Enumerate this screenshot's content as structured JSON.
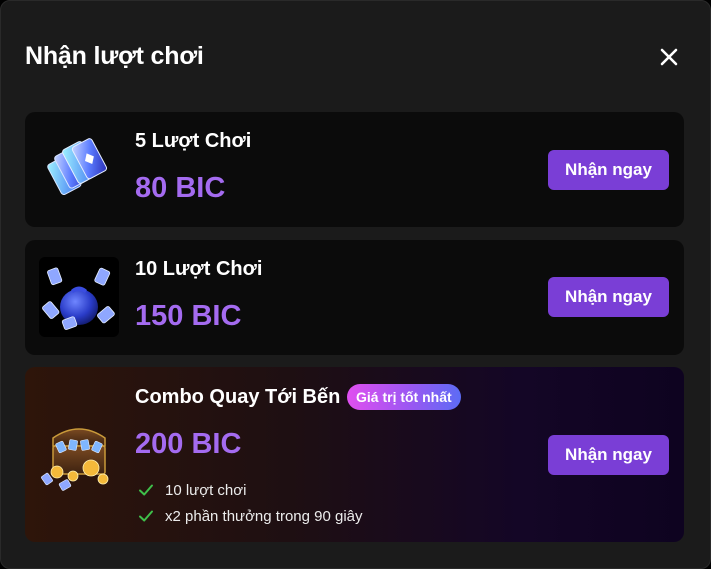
{
  "modal": {
    "title": "Nhận lượt chơi",
    "close_icon": "close-icon"
  },
  "colors": {
    "background": "#1b1b1b",
    "card": "#0b0b0b",
    "price": "#a46bf0",
    "button": "#7a3ed6",
    "check": "#3fbf4a"
  },
  "packages": [
    {
      "name": "5 Lượt Chơi",
      "price": "80 BIC",
      "button": "Nhận ngay",
      "icon": "tickets-icon"
    },
    {
      "name": "10 Lượt Chơi",
      "price": "150 BIC",
      "button": "Nhận ngay",
      "icon": "ticket-pouch-icon"
    },
    {
      "name": "Combo Quay Tới Bến",
      "badge": "Giá trị tốt nhất",
      "price": "200 BIC",
      "button": "Nhận ngay",
      "icon": "treasure-chest-icon",
      "benefits": [
        "10 lượt chơi",
        "x2 phần thưởng trong 90 giây"
      ]
    }
  ]
}
